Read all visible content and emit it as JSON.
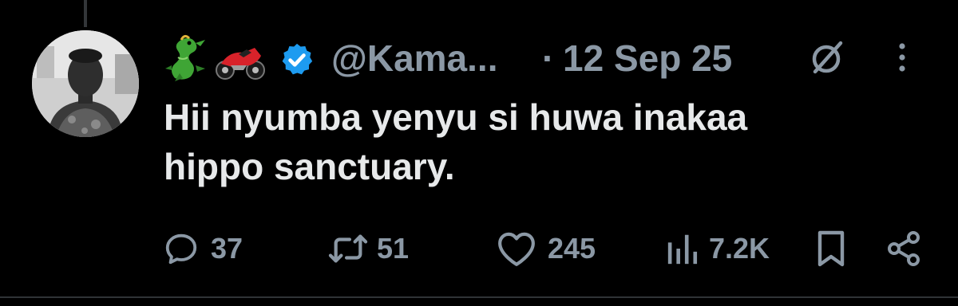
{
  "tweet": {
    "display_name_emojis": [
      "dragon",
      "motorcycle"
    ],
    "handle": "@Kama...",
    "separator": "·",
    "date": "12 Sep 25",
    "verified": true,
    "text_line1": "Hii nyumba yenyu si huwa inakaa",
    "text_line2": "hippo sanctuary."
  },
  "actions": {
    "replies": "37",
    "reposts": "51",
    "likes": "245",
    "views": "7.2K"
  },
  "icons": {
    "reply": "reply-icon",
    "repost": "repost-icon",
    "like": "heart-icon",
    "views": "analytics-icon",
    "bookmark": "bookmark-icon",
    "share": "share-icon",
    "grok": "grok-icon",
    "more": "more-icon",
    "verified": "verified-badge-icon"
  },
  "colors": {
    "background": "#000000",
    "text_primary": "#e7e9ea",
    "text_secondary": "#8b98a5",
    "verified_blue": "#1d9bf0"
  }
}
